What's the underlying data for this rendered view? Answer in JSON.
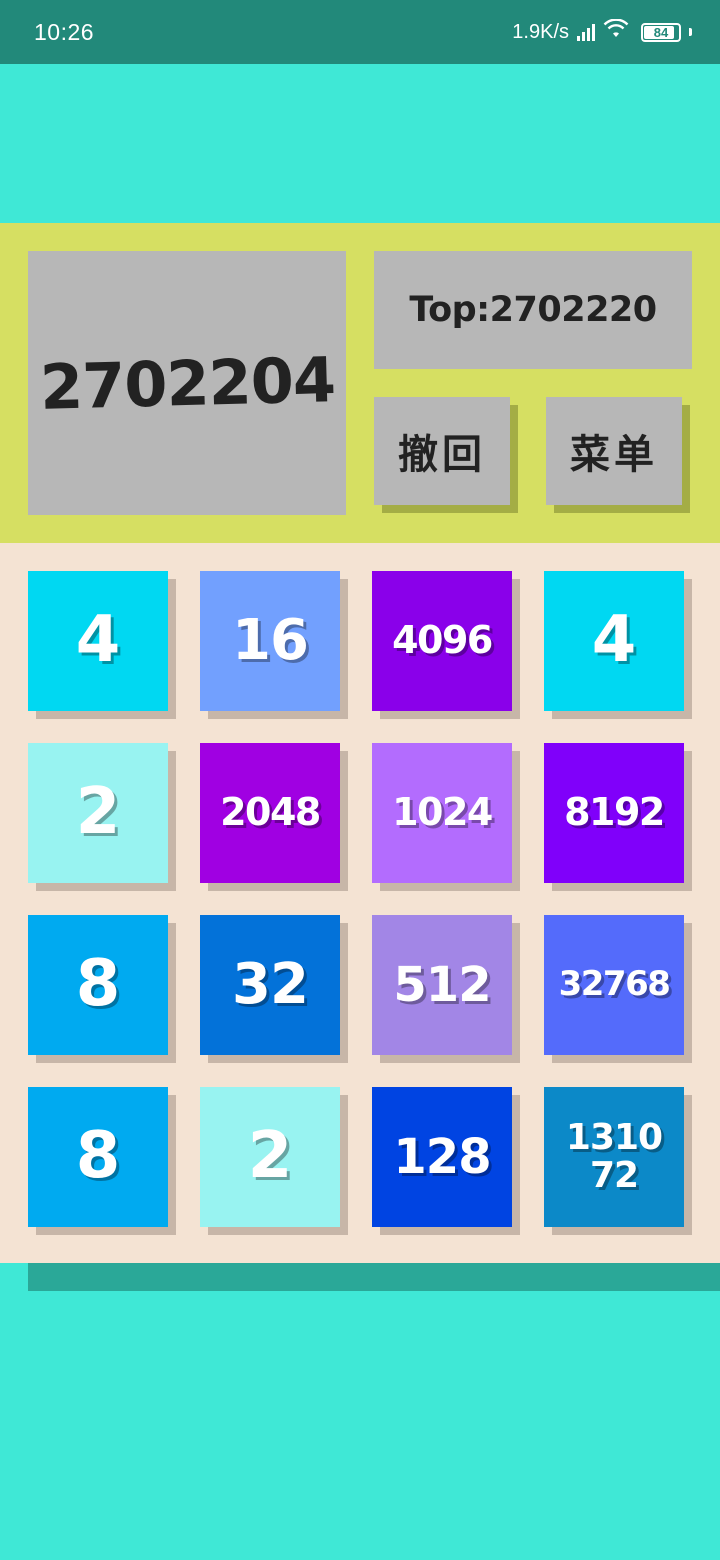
{
  "status_bar": {
    "time": "10:26",
    "network_speed": "1.9K/s",
    "battery_level": "84",
    "icons": [
      "signal-icon",
      "wifi-icon",
      "battery-icon"
    ]
  },
  "header": {
    "score": "2702204",
    "top_label": "Top:2702220",
    "undo_button": "撤回",
    "menu_button": "菜单"
  },
  "board": {
    "rows": [
      [
        {
          "value": "4",
          "color": "#00d8f2"
        },
        {
          "value": "16",
          "color": "#72a0fe"
        },
        {
          "value": "4096",
          "color": "#8a00ea"
        },
        {
          "value": "4",
          "color": "#00d8f2"
        }
      ],
      [
        {
          "value": "2",
          "color": "#98f3f1"
        },
        {
          "value": "2048",
          "color": "#a000e2"
        },
        {
          "value": "1024",
          "color": "#b36cfe"
        },
        {
          "value": "8192",
          "color": "#8000fa"
        }
      ],
      [
        {
          "value": "8",
          "color": "#00aaf0"
        },
        {
          "value": "32",
          "color": "#0372d9"
        },
        {
          "value": "512",
          "color": "#a286e6"
        },
        {
          "value": "32768",
          "color": "#546bfb"
        }
      ],
      [
        {
          "value": "8",
          "color": "#00aaf0"
        },
        {
          "value": "2",
          "color": "#98f3f1"
        },
        {
          "value": "128",
          "color": "#0044e2"
        },
        {
          "value": "131072",
          "color": "#0c89c8"
        }
      ]
    ]
  },
  "colors": {
    "background": "#3fe8d6",
    "status_bar": "#22897a",
    "header_panel": "#d6df62",
    "board": "#f4e3d3",
    "panel_box": "#b7b7b7",
    "bottom_bar": "#2aa898"
  }
}
